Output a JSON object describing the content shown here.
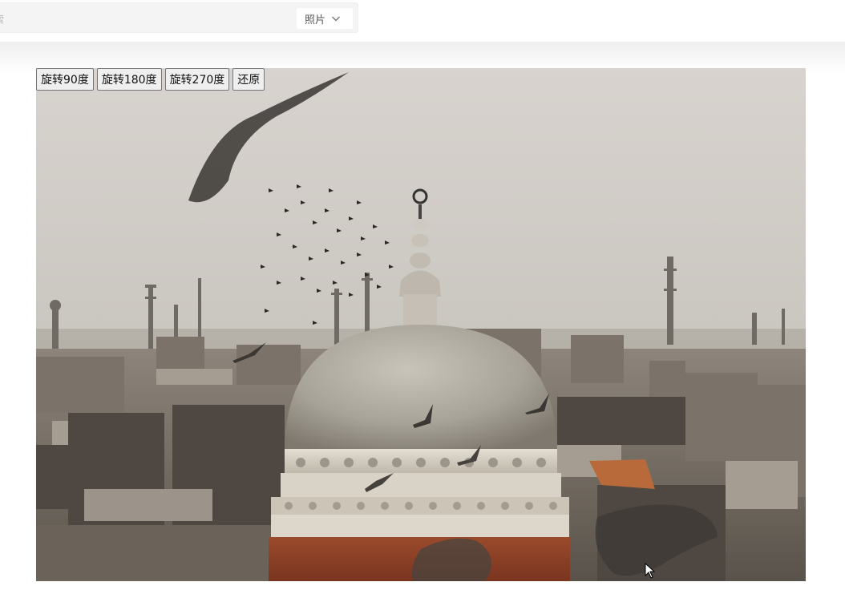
{
  "search": {
    "placeholder": "索",
    "category": "照片"
  },
  "toolbar": {
    "rotate90": "旋转90度",
    "rotate180": "旋转180度",
    "rotate270": "旋转270度",
    "restore": "还原"
  },
  "icons": {
    "dropdown": "chevron-down-icon",
    "cursor": "mouse-pointer-icon"
  }
}
